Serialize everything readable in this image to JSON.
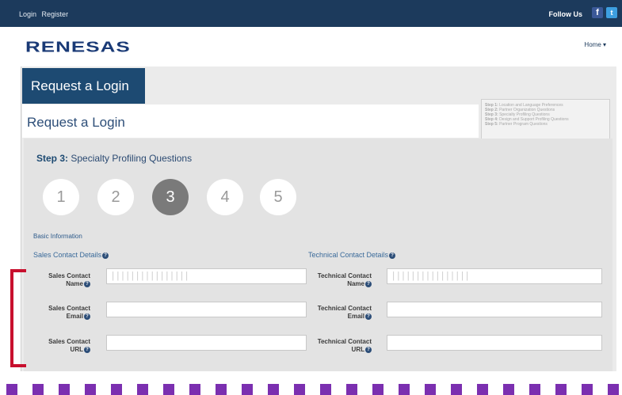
{
  "topbar": {
    "login": "Login",
    "register": "Register",
    "follow_us": "Follow Us",
    "facebook_glyph": "f",
    "twitter_glyph": "t"
  },
  "header": {
    "logo": "RENESAS",
    "home": "Home ▾"
  },
  "tab_title": "Request a Login",
  "page_title": "Request a Login",
  "steps_list": [
    {
      "label": "Step 1:",
      "text": "Location and Language Preferences"
    },
    {
      "label": "Step 2:",
      "text": "Partner Organization Questions"
    },
    {
      "label": "Step 3:",
      "text": "Specialty Profiling Questions"
    },
    {
      "label": "Step 4:",
      "text": "Design and Support Profiling Questions"
    },
    {
      "label": "Step 5:",
      "text": "Partner Program Questions"
    }
  ],
  "current_step": {
    "label": "Step 3:",
    "text": "Specialty Profiling Questions"
  },
  "step_numbers": [
    "1",
    "2",
    "3",
    "4",
    "5"
  ],
  "active_step": 3,
  "section_title": "Basic Information",
  "sales": {
    "heading": "Sales Contact Details",
    "name_label_1": "Sales Contact",
    "name_label_2": "Name",
    "email_label_1": "Sales Contact",
    "email_label_2": "Email",
    "url_label_1": "Sales Contact",
    "url_label_2": "URL",
    "name_value": "||||||||||||||||",
    "email_value": "",
    "url_value": ""
  },
  "technical": {
    "heading": "Technical Contact Details",
    "name_label_1": "Technical Contact",
    "name_label_2": "Name",
    "email_label_1": "Technical Contact",
    "email_label_2": "Email",
    "url_label_1": "Technical Contact",
    "url_label_2": "URL",
    "name_value": "||||||||||||||||",
    "email_value": "",
    "url_value": ""
  },
  "help_glyph": "?",
  "colors": {
    "topbar": "#1c3a5c",
    "tab": "#1d4a72",
    "active_step": "#7a7a7a",
    "annotation_red": "#c8102e",
    "dash_purple": "#7b2fb0"
  }
}
